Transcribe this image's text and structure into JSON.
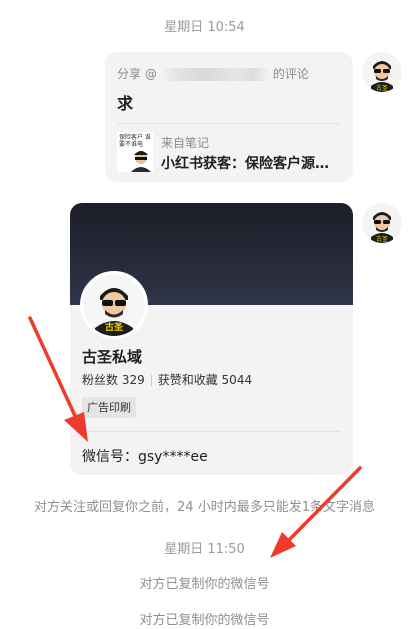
{
  "timestamps": {
    "first": "星期日 10:54",
    "second": "星期日 11:50"
  },
  "share_card": {
    "header_prefix": "分享 @",
    "header_suffix": "的评论",
    "comment": "求",
    "source_label": "来自笔记",
    "note_title": "小红书获客：保险客户源…",
    "thumbnail_text": "保险客户 谁要不谁电"
  },
  "profile_card": {
    "name": "古圣私域",
    "followers": "粉丝数 329",
    "likes": "获赞和收藏 5044",
    "tag": "广告印刷",
    "wechat": "微信号：gsy****ee"
  },
  "avatar_caption": "古圣",
  "system_notes": {
    "limit_notice": "对方关注或回复你之前，24 小时内最多只能发1条文字消息",
    "copied_1": "对方已复制你的微信号",
    "copied_2": "对方已复制你的微信号"
  },
  "colors": {
    "annotation_arrow": "#f03a2c",
    "card_bg": "#f3f3f3",
    "banner_dark": "#1c1f29"
  },
  "icons": {
    "avatar": "cartoon-man-sunglasses-icon",
    "arrow": "red-annotation-arrow"
  }
}
